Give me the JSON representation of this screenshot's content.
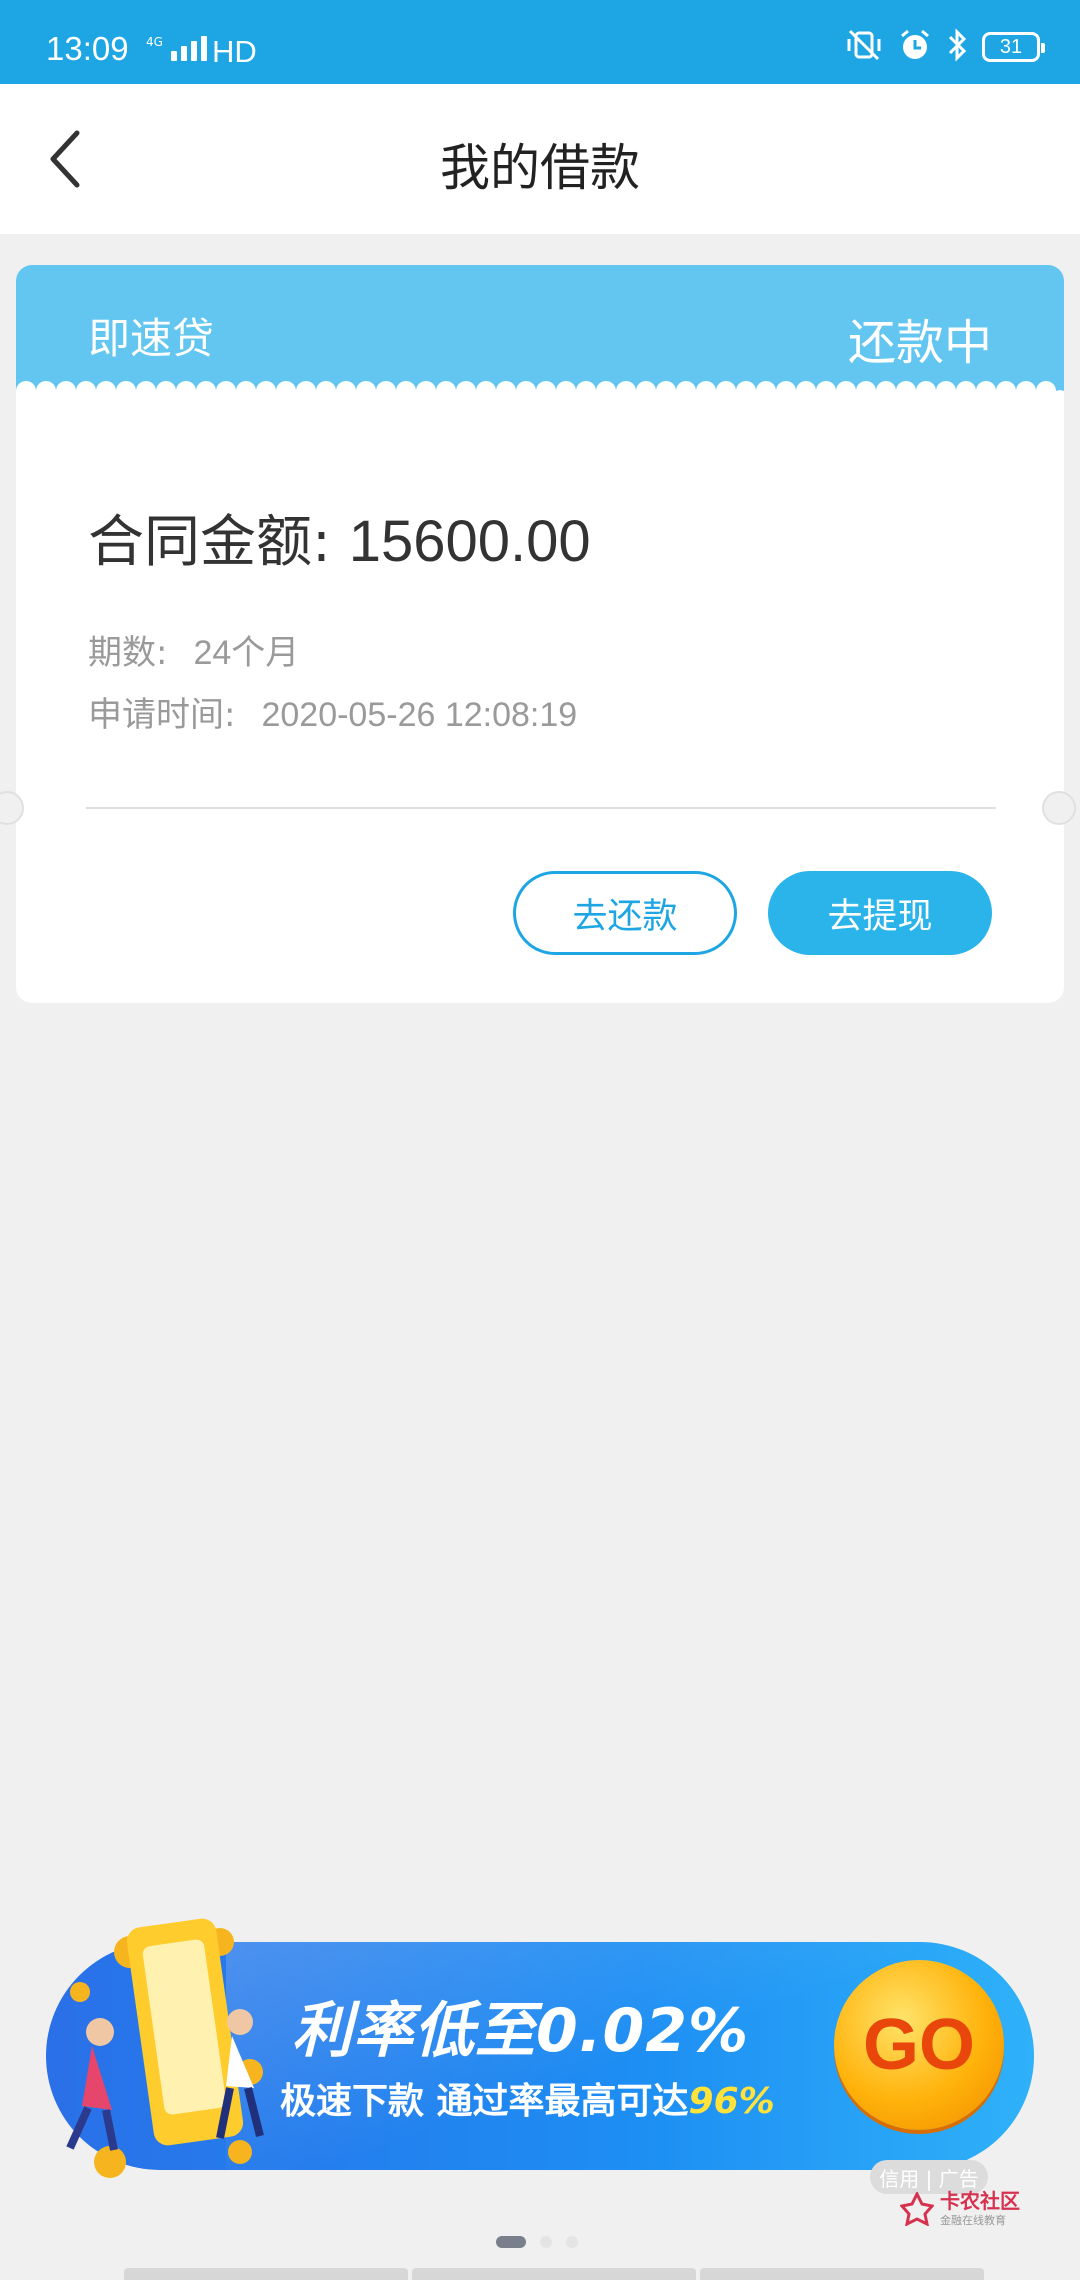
{
  "status_bar": {
    "time": "13:09",
    "network": "4G",
    "hd": "HD",
    "battery": "31"
  },
  "nav": {
    "title": "我的借款"
  },
  "loan": {
    "product": "即速贷",
    "status": "还款中",
    "amount_label": "合同金额:",
    "amount_value": "15600.00",
    "periods_label": "期数:",
    "periods_value": "24个月",
    "apply_label": "申请时间:",
    "apply_value": "2020-05-26 12:08:19",
    "repay_button": "去还款",
    "withdraw_button": "去提现"
  },
  "ad": {
    "headline": "利率低至0.02%",
    "sub_prefix": "极速下款 通过率最高可达",
    "sub_highlight": "96%",
    "go_label": "GO",
    "tag": "信用 | 广告"
  },
  "watermark": {
    "name": "卡农社区",
    "sub": "金融在线教育"
  },
  "colors": {
    "status_bar": "#1ea6e4",
    "card_header": "#63c6f0",
    "accent": "#1ea6e4",
    "go_text": "#e8460a"
  }
}
